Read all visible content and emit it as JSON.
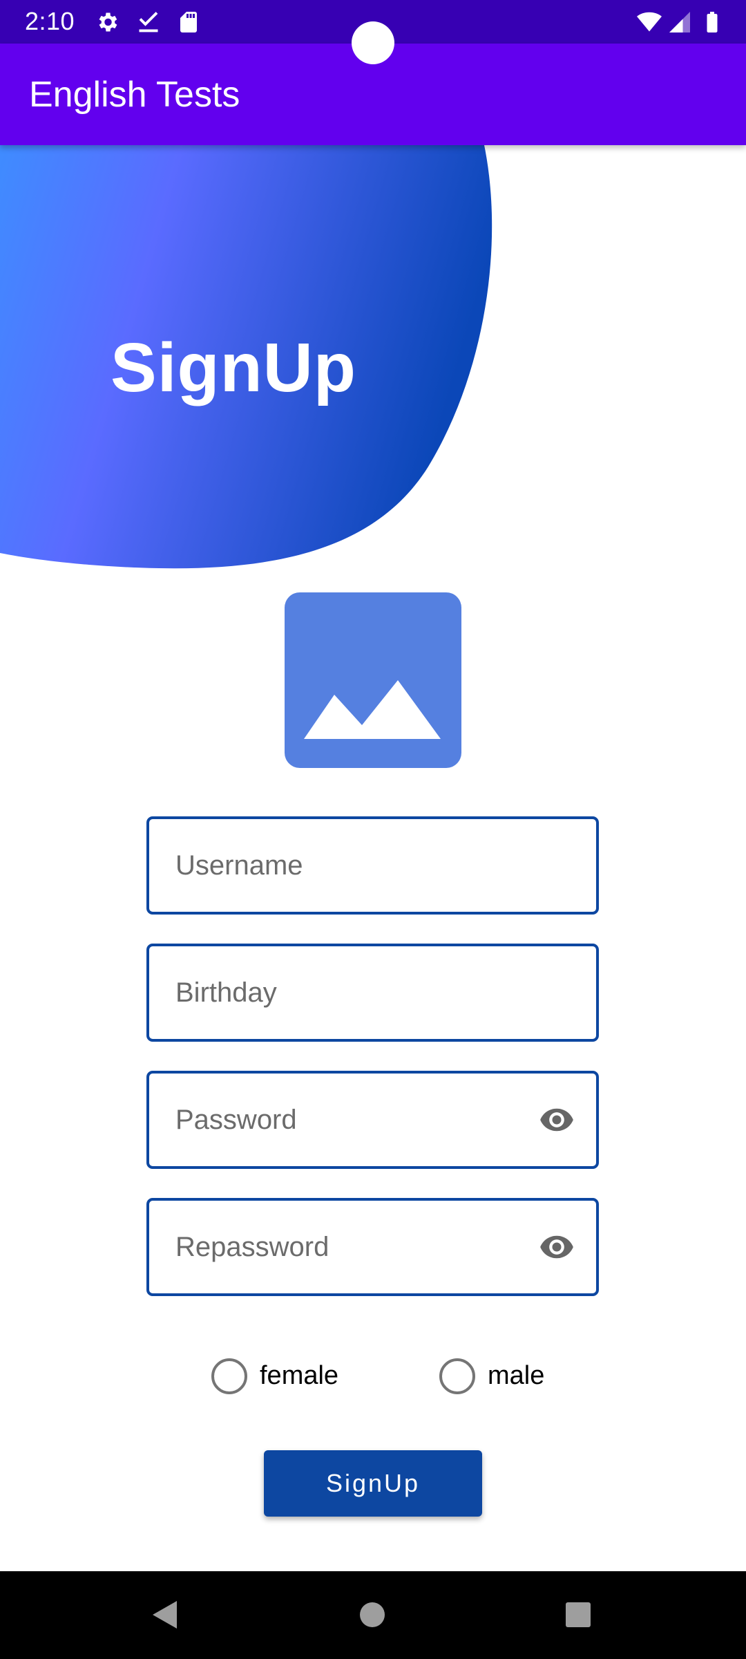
{
  "status_bar": {
    "time": "2:10"
  },
  "app_bar": {
    "title": "English Tests"
  },
  "header": {
    "title": "SignUp"
  },
  "form": {
    "username_placeholder": "Username",
    "birthday_placeholder": "Birthday",
    "password_placeholder": "Password",
    "repassword_placeholder": "Repassword"
  },
  "gender": {
    "options": [
      {
        "label": "female",
        "selected": false
      },
      {
        "label": "male",
        "selected": false
      }
    ]
  },
  "actions": {
    "signup_label": "SignUp"
  },
  "colors": {
    "status_bar": "#3700b3",
    "app_bar": "#6200ee",
    "accent": "#0d47a1",
    "image_placeholder": "#5580e0"
  },
  "icons": {
    "status_bar": [
      "gear-icon",
      "download-done-icon",
      "sd-card-icon",
      "wifi-icon",
      "cellular-signal-icon",
      "battery-icon"
    ],
    "nav_bar": [
      "back-icon",
      "home-icon",
      "recents-icon"
    ]
  }
}
